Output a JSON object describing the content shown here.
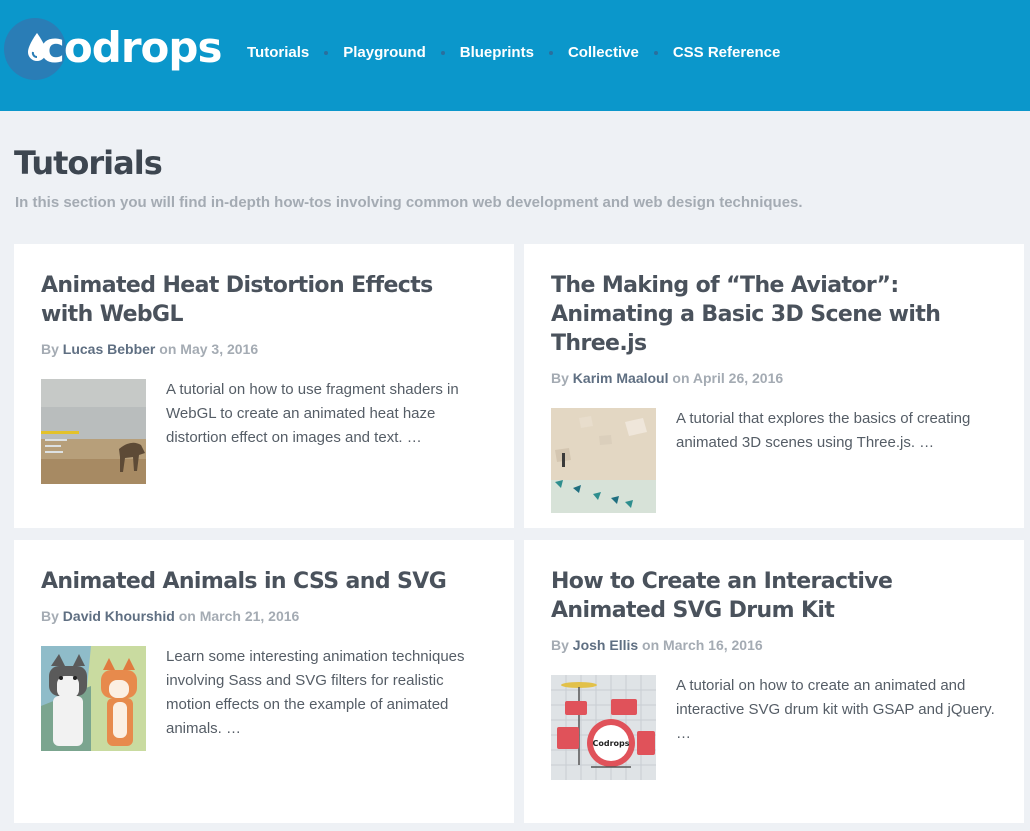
{
  "header": {
    "logo_text": "codrops",
    "nav": [
      "Tutorials",
      "Playground",
      "Blueprints",
      "Collective",
      "CSS Reference"
    ]
  },
  "page": {
    "title": "Tutorials",
    "intro": "In this section you will find in-depth how-tos involving common web development and web design techniques."
  },
  "labels": {
    "by": "By",
    "on": "on"
  },
  "articles": [
    {
      "title": "Animated Heat Distortion Effects with WebGL",
      "author": "Lucas Bebber",
      "date": "May 3, 2016",
      "excerpt": "A tutorial on how to use fragment shaders in WebGL to create an animated heat haze distortion effect on images and text. …"
    },
    {
      "title": "The Making of “The Aviator”: Animating a Basic 3D Scene with Three.js",
      "author": "Karim Maaloul",
      "date": "April 26, 2016",
      "excerpt": "A tutorial that explores the basics of creating animated 3D scenes using Three.js. …"
    },
    {
      "title": "Animated Animals in CSS and SVG",
      "author": "David Khourshid",
      "date": "March 21, 2016",
      "excerpt": "Learn some interesting animation techniques involving Sass and SVG filters for realistic motion effects on the example of animated animals. …"
    },
    {
      "title": "How to Create an Interactive Animated SVG Drum Kit",
      "author": "Josh Ellis",
      "date": "March 16, 2016",
      "excerpt": "A tutorial on how to create an animated and interactive SVG drum kit with GSAP and jQuery. …"
    }
  ],
  "colors": {
    "header_bg": "#0b97cb",
    "page_bg": "#eef1f5",
    "card_bg": "#ffffff",
    "title_text": "#4a525c",
    "muted_text": "#a4abb3",
    "author_text": "#5f6f82"
  }
}
